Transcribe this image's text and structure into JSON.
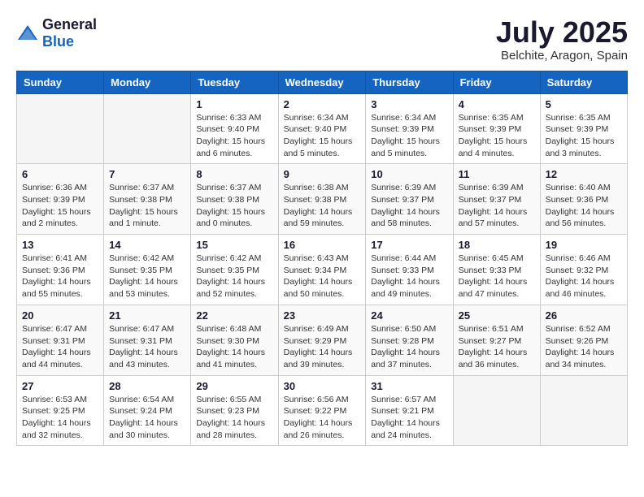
{
  "logo": {
    "general": "General",
    "blue": "Blue"
  },
  "header": {
    "month": "July 2025",
    "location": "Belchite, Aragon, Spain"
  },
  "weekdays": [
    "Sunday",
    "Monday",
    "Tuesday",
    "Wednesday",
    "Thursday",
    "Friday",
    "Saturday"
  ],
  "weeks": [
    [
      {
        "day": "",
        "info": ""
      },
      {
        "day": "",
        "info": ""
      },
      {
        "day": "1",
        "info": "Sunrise: 6:33 AM\nSunset: 9:40 PM\nDaylight: 15 hours and 6 minutes."
      },
      {
        "day": "2",
        "info": "Sunrise: 6:34 AM\nSunset: 9:40 PM\nDaylight: 15 hours and 5 minutes."
      },
      {
        "day": "3",
        "info": "Sunrise: 6:34 AM\nSunset: 9:39 PM\nDaylight: 15 hours and 5 minutes."
      },
      {
        "day": "4",
        "info": "Sunrise: 6:35 AM\nSunset: 9:39 PM\nDaylight: 15 hours and 4 minutes."
      },
      {
        "day": "5",
        "info": "Sunrise: 6:35 AM\nSunset: 9:39 PM\nDaylight: 15 hours and 3 minutes."
      }
    ],
    [
      {
        "day": "6",
        "info": "Sunrise: 6:36 AM\nSunset: 9:39 PM\nDaylight: 15 hours and 2 minutes."
      },
      {
        "day": "7",
        "info": "Sunrise: 6:37 AM\nSunset: 9:38 PM\nDaylight: 15 hours and 1 minute."
      },
      {
        "day": "8",
        "info": "Sunrise: 6:37 AM\nSunset: 9:38 PM\nDaylight: 15 hours and 0 minutes."
      },
      {
        "day": "9",
        "info": "Sunrise: 6:38 AM\nSunset: 9:38 PM\nDaylight: 14 hours and 59 minutes."
      },
      {
        "day": "10",
        "info": "Sunrise: 6:39 AM\nSunset: 9:37 PM\nDaylight: 14 hours and 58 minutes."
      },
      {
        "day": "11",
        "info": "Sunrise: 6:39 AM\nSunset: 9:37 PM\nDaylight: 14 hours and 57 minutes."
      },
      {
        "day": "12",
        "info": "Sunrise: 6:40 AM\nSunset: 9:36 PM\nDaylight: 14 hours and 56 minutes."
      }
    ],
    [
      {
        "day": "13",
        "info": "Sunrise: 6:41 AM\nSunset: 9:36 PM\nDaylight: 14 hours and 55 minutes."
      },
      {
        "day": "14",
        "info": "Sunrise: 6:42 AM\nSunset: 9:35 PM\nDaylight: 14 hours and 53 minutes."
      },
      {
        "day": "15",
        "info": "Sunrise: 6:42 AM\nSunset: 9:35 PM\nDaylight: 14 hours and 52 minutes."
      },
      {
        "day": "16",
        "info": "Sunrise: 6:43 AM\nSunset: 9:34 PM\nDaylight: 14 hours and 50 minutes."
      },
      {
        "day": "17",
        "info": "Sunrise: 6:44 AM\nSunset: 9:33 PM\nDaylight: 14 hours and 49 minutes."
      },
      {
        "day": "18",
        "info": "Sunrise: 6:45 AM\nSunset: 9:33 PM\nDaylight: 14 hours and 47 minutes."
      },
      {
        "day": "19",
        "info": "Sunrise: 6:46 AM\nSunset: 9:32 PM\nDaylight: 14 hours and 46 minutes."
      }
    ],
    [
      {
        "day": "20",
        "info": "Sunrise: 6:47 AM\nSunset: 9:31 PM\nDaylight: 14 hours and 44 minutes."
      },
      {
        "day": "21",
        "info": "Sunrise: 6:47 AM\nSunset: 9:31 PM\nDaylight: 14 hours and 43 minutes."
      },
      {
        "day": "22",
        "info": "Sunrise: 6:48 AM\nSunset: 9:30 PM\nDaylight: 14 hours and 41 minutes."
      },
      {
        "day": "23",
        "info": "Sunrise: 6:49 AM\nSunset: 9:29 PM\nDaylight: 14 hours and 39 minutes."
      },
      {
        "day": "24",
        "info": "Sunrise: 6:50 AM\nSunset: 9:28 PM\nDaylight: 14 hours and 37 minutes."
      },
      {
        "day": "25",
        "info": "Sunrise: 6:51 AM\nSunset: 9:27 PM\nDaylight: 14 hours and 36 minutes."
      },
      {
        "day": "26",
        "info": "Sunrise: 6:52 AM\nSunset: 9:26 PM\nDaylight: 14 hours and 34 minutes."
      }
    ],
    [
      {
        "day": "27",
        "info": "Sunrise: 6:53 AM\nSunset: 9:25 PM\nDaylight: 14 hours and 32 minutes."
      },
      {
        "day": "28",
        "info": "Sunrise: 6:54 AM\nSunset: 9:24 PM\nDaylight: 14 hours and 30 minutes."
      },
      {
        "day": "29",
        "info": "Sunrise: 6:55 AM\nSunset: 9:23 PM\nDaylight: 14 hours and 28 minutes."
      },
      {
        "day": "30",
        "info": "Sunrise: 6:56 AM\nSunset: 9:22 PM\nDaylight: 14 hours and 26 minutes."
      },
      {
        "day": "31",
        "info": "Sunrise: 6:57 AM\nSunset: 9:21 PM\nDaylight: 14 hours and 24 minutes."
      },
      {
        "day": "",
        "info": ""
      },
      {
        "day": "",
        "info": ""
      }
    ]
  ]
}
